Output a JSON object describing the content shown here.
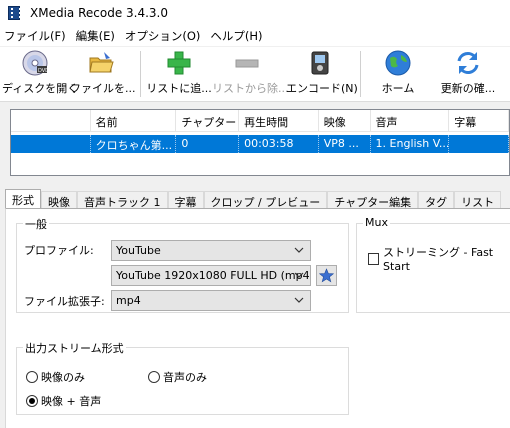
{
  "window": {
    "title": "XMedia Recode 3.4.3.0"
  },
  "menu": [
    "ファイル(F)",
    "編集(E)",
    "オプション(O)",
    "ヘルプ(H)"
  ],
  "toolbar": {
    "open_disc": "ディスクを開く",
    "open_file": "ファイルを...",
    "add_to_list": "リストに追...",
    "remove_from_list": "リストから除...",
    "encode": "エンコード(N)",
    "home": "ホーム",
    "check_update": "更新の確..."
  },
  "file_list": {
    "headers": [
      "名前",
      "チャプター",
      "再生時間",
      "映像",
      "音声",
      "字幕"
    ],
    "rows": [
      {
        "name": "クロちゃん第...",
        "chapter": "0",
        "duration": "00:03:58",
        "video": "VP8 ...",
        "audio": "1. English V...",
        "subtitle": ""
      }
    ]
  },
  "tabs": [
    "形式",
    "映像",
    "音声トラック 1",
    "字幕",
    "クロップ / プレビュー",
    "チャプター編集",
    "タグ",
    "リスト"
  ],
  "format_tab": {
    "general_group": "一般",
    "profile_label": "プロファイル:",
    "profile_value": "YouTube",
    "preset_value": "YouTube 1920x1080 FULL HD (mp4)",
    "extension_label": "ファイル拡張子:",
    "extension_value": "mp4",
    "mux_group": "Mux",
    "streaming_label": "ストリーミング - Fast Start",
    "streaming_checked": false,
    "output_group": "出力ストリーム形式",
    "video_only": "映像のみ",
    "audio_only": "音声のみ",
    "video_audio": "映像 + 音声",
    "selected_output": "video_audio"
  },
  "colors": {
    "selection": "#0078d7",
    "star": "#3b6fd0"
  }
}
